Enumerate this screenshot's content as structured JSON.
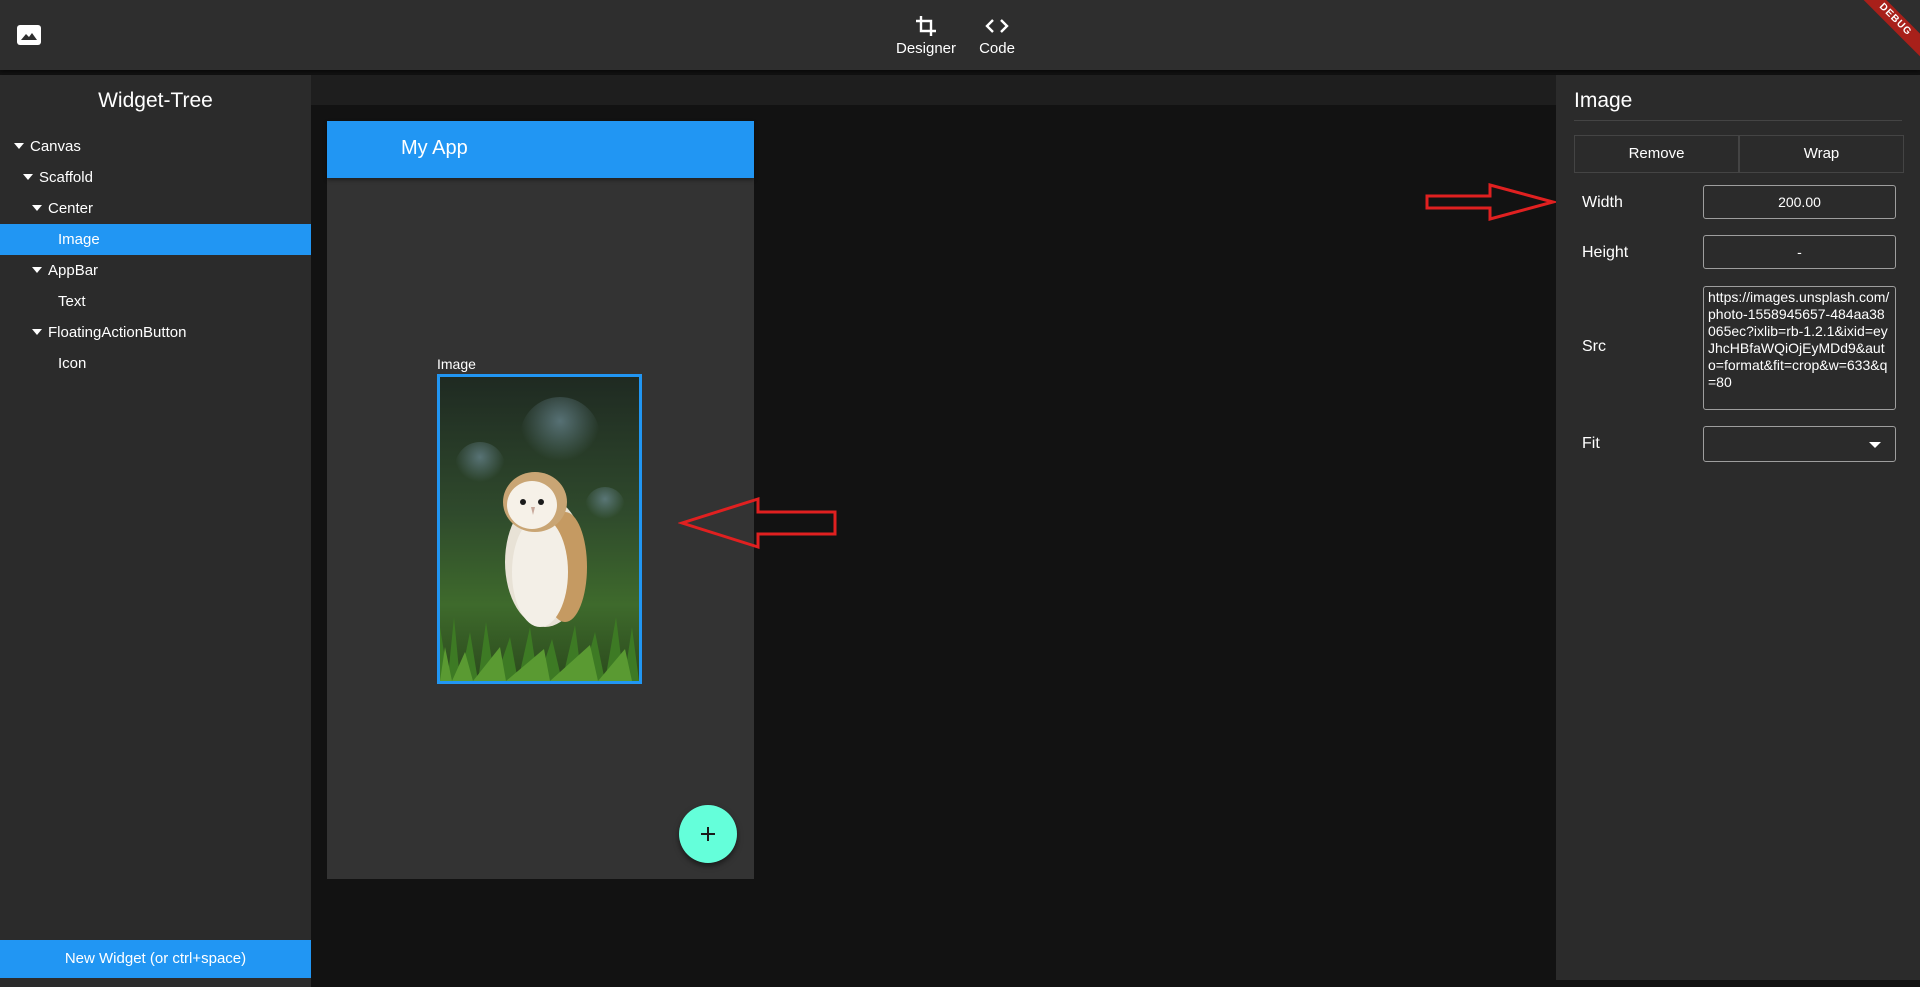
{
  "toolbar": {
    "designer_label": "Designer",
    "code_label": "Code",
    "debug_badge": "DEBUG"
  },
  "widget_tree": {
    "title": "Widget-Tree",
    "items": [
      {
        "label": "Canvas",
        "expanded": true
      },
      {
        "label": "Scaffold",
        "expanded": true
      },
      {
        "label": "Center",
        "expanded": true
      },
      {
        "label": "Image",
        "selected": true
      },
      {
        "label": "AppBar",
        "expanded": true
      },
      {
        "label": "Text"
      },
      {
        "label": "FloatingActionButton",
        "expanded": true
      },
      {
        "label": "Icon"
      }
    ],
    "new_widget_label": "New Widget (or ctrl+space)"
  },
  "preview": {
    "app_title": "My App",
    "image_label": "Image",
    "fab_icon": "plus-icon"
  },
  "properties": {
    "title": "Image",
    "remove_label": "Remove",
    "wrap_label": "Wrap",
    "width_label": "Width",
    "width_value": "200.00",
    "height_label": "Height",
    "height_value": "-",
    "src_label": "Src",
    "src_value": "https://images.unsplash.com/photo-1558945657-484aa38065ec?ixlib=rb-1.2.1&ixid=eyJhcHBfaWQiOjEyMDd9&auto=format&fit=crop&w=633&q=80",
    "fit_label": "Fit",
    "fit_value": ""
  },
  "colors": {
    "accent": "#2196f3",
    "fab": "#64ffda",
    "annotation_arrow": "#e02020"
  }
}
